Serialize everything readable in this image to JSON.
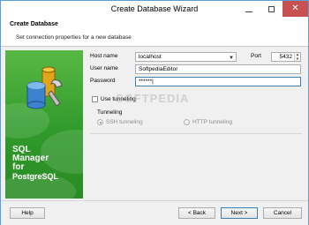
{
  "window": {
    "title": "Create Database Wizard"
  },
  "header": {
    "title": "Create Database",
    "subtitle": "Set connection properties for a new database"
  },
  "banner": {
    "product_lines": [
      "SQL",
      "Manager",
      "for",
      "PostgreSQL"
    ],
    "colors": {
      "top": "#59b845",
      "bottom": "#2a8b24"
    }
  },
  "form": {
    "host": {
      "label": "Host name",
      "value": "localhost"
    },
    "port": {
      "label": "Port",
      "value": "5432"
    },
    "user": {
      "label": "User name",
      "value": "SoftpediaEditor"
    },
    "password": {
      "label": "Password",
      "value": "******|"
    },
    "use_tunneling": {
      "label": "Use tunneling",
      "checked": false
    },
    "tunneling": {
      "group_label": "Tunneling",
      "options": [
        {
          "label": "SSH tunneling",
          "selected": true
        },
        {
          "label": "HTTP tunneling",
          "selected": false
        }
      ]
    }
  },
  "watermark": "SOFTPEDIA",
  "footer": {
    "help": "Help",
    "back": "< Back",
    "next": "Next >",
    "cancel": "Cancel"
  }
}
